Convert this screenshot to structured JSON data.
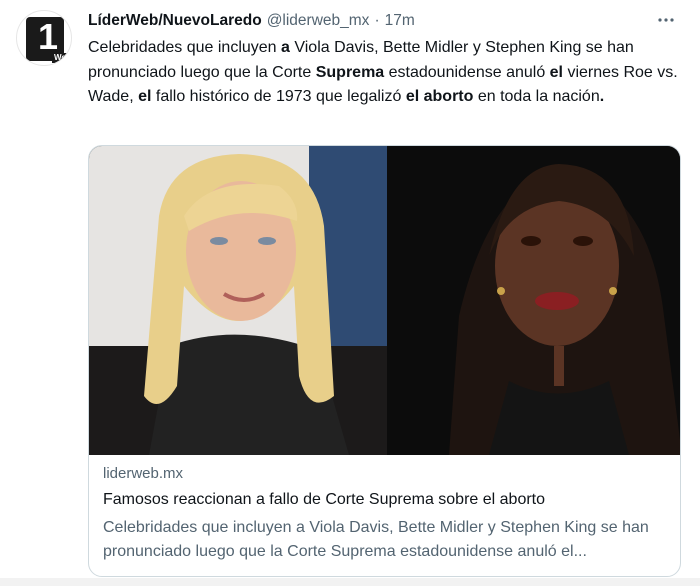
{
  "tweet": {
    "author_name": "LíderWeb/NuevoLaredo",
    "author_handle": "@liderweb_mx",
    "separator": "·",
    "time": "17m",
    "more_icon": "more-horizontal-icon",
    "avatar": {
      "one": "1",
      "web": "Web"
    },
    "text_segments": [
      {
        "t": "Celebridades que incluyen ",
        "b": false
      },
      {
        "t": "a",
        "b": true
      },
      {
        "t": " Viola Davis, Bette Midler y Stephen King se han pronunciado luego que la Corte ",
        "b": false
      },
      {
        "t": "Suprema",
        "b": true
      },
      {
        "t": " estadounidense anuló ",
        "b": false
      },
      {
        "t": "el",
        "b": true
      },
      {
        "t": " viernes Roe vs. Wade, ",
        "b": false
      },
      {
        "t": "el",
        "b": true
      },
      {
        "t": " fallo histórico de 1973 que legalizó ",
        "b": false
      },
      {
        "t": "el aborto",
        "b": true
      },
      {
        "t": " en toda la nación",
        "b": false
      },
      {
        "t": ".",
        "b": true
      }
    ]
  },
  "card": {
    "domain": "liderweb.mx",
    "title": "Famosos reaccionan a fallo de Corte Suprema sobre el aborto",
    "description": "Celebridades que incluyen a Viola Davis, Bette Midler y Stephen King se han pronunciado luego que la Corte Suprema estadounidense anuló el..."
  },
  "colors": {
    "text_primary": "#0f1419",
    "text_secondary": "#536471",
    "border": "#cfd9de"
  }
}
